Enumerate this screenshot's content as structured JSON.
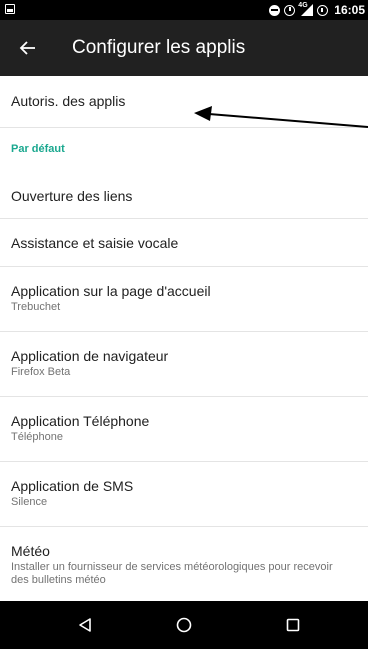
{
  "status_bar": {
    "time": "16:05",
    "network": "4G",
    "icons": [
      "notification-icon",
      "do-not-disturb-icon",
      "alarm-icon",
      "signal-icon",
      "battery-icon"
    ]
  },
  "app_bar": {
    "title": "Configurer les applis",
    "back_icon": "arrow-back-icon"
  },
  "list": {
    "app_permissions": {
      "title": "Autoris. des applis"
    },
    "default_header": "Par défaut",
    "items": [
      {
        "title": "Ouverture des liens",
        "subtitle": ""
      },
      {
        "title": "Assistance et saisie vocale",
        "subtitle": ""
      },
      {
        "title": "Application sur la page d'accueil",
        "subtitle": "Trebuchet"
      },
      {
        "title": "Application de navigateur",
        "subtitle": "Firefox Beta"
      },
      {
        "title": "Application Téléphone",
        "subtitle": "Téléphone"
      },
      {
        "title": "Application de SMS",
        "subtitle": "Silence"
      },
      {
        "title": "Météo",
        "subtitle": "Installer un fournisseur de services météorologiques pour recevoir des bulletins météo"
      }
    ]
  },
  "nav_bar": {
    "icons": [
      "back-triangle-icon",
      "home-circle-icon",
      "recents-square-icon"
    ]
  },
  "colors": {
    "status_bar": "#000000",
    "app_bar": "#212121",
    "accent": "#1aa88f",
    "nav_bar": "#000000"
  }
}
